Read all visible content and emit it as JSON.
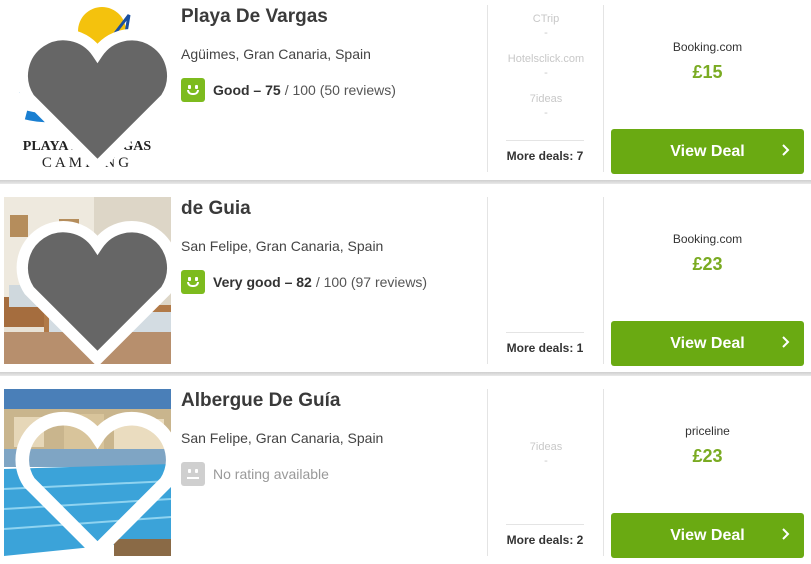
{
  "listings": [
    {
      "name": "Playa De Vargas",
      "location": "Agüimes, Gran Canaria, Spain",
      "rating_label": "Good – 75",
      "rating_rest": "/ 100 (50 reviews)",
      "rating_state": "green",
      "providers": [
        "CTrip",
        "Hotelsclick.com",
        "7ideas"
      ],
      "provider_dash": "-",
      "more_deals": "More deals: 7",
      "site": "Booking.com",
      "price": "£15",
      "deal_label": "View Deal",
      "logo_text_1": "PLAYA DE VARGAS",
      "logo_text_2": "CAMPING"
    },
    {
      "name": "de Guia",
      "location": "San Felipe, Gran Canaria, Spain",
      "rating_label": "Very good – 82",
      "rating_rest": "/ 100 (97 reviews)",
      "rating_state": "green",
      "providers": [],
      "provider_dash": "-",
      "more_deals": "More deals: 1",
      "site": "Booking.com",
      "price": "£23",
      "deal_label": "View Deal"
    },
    {
      "name": "Albergue De Guía",
      "location": "San Felipe, Gran Canaria, Spain",
      "rating_none": "No rating available",
      "rating_state": "grey",
      "providers": [
        "7ideas"
      ],
      "provider_dash": "-",
      "more_deals": "More deals: 2",
      "site": "priceline",
      "price": "£23",
      "deal_label": "View Deal"
    }
  ],
  "colors": {
    "deal_button": "#6aaa12",
    "price": "#7aab22",
    "rating_face_green": "#7dbb1e",
    "rating_face_grey": "#cfcfcf"
  },
  "icons": [
    "heart-icon",
    "rating-face-icon",
    "chevron-right-icon"
  ]
}
